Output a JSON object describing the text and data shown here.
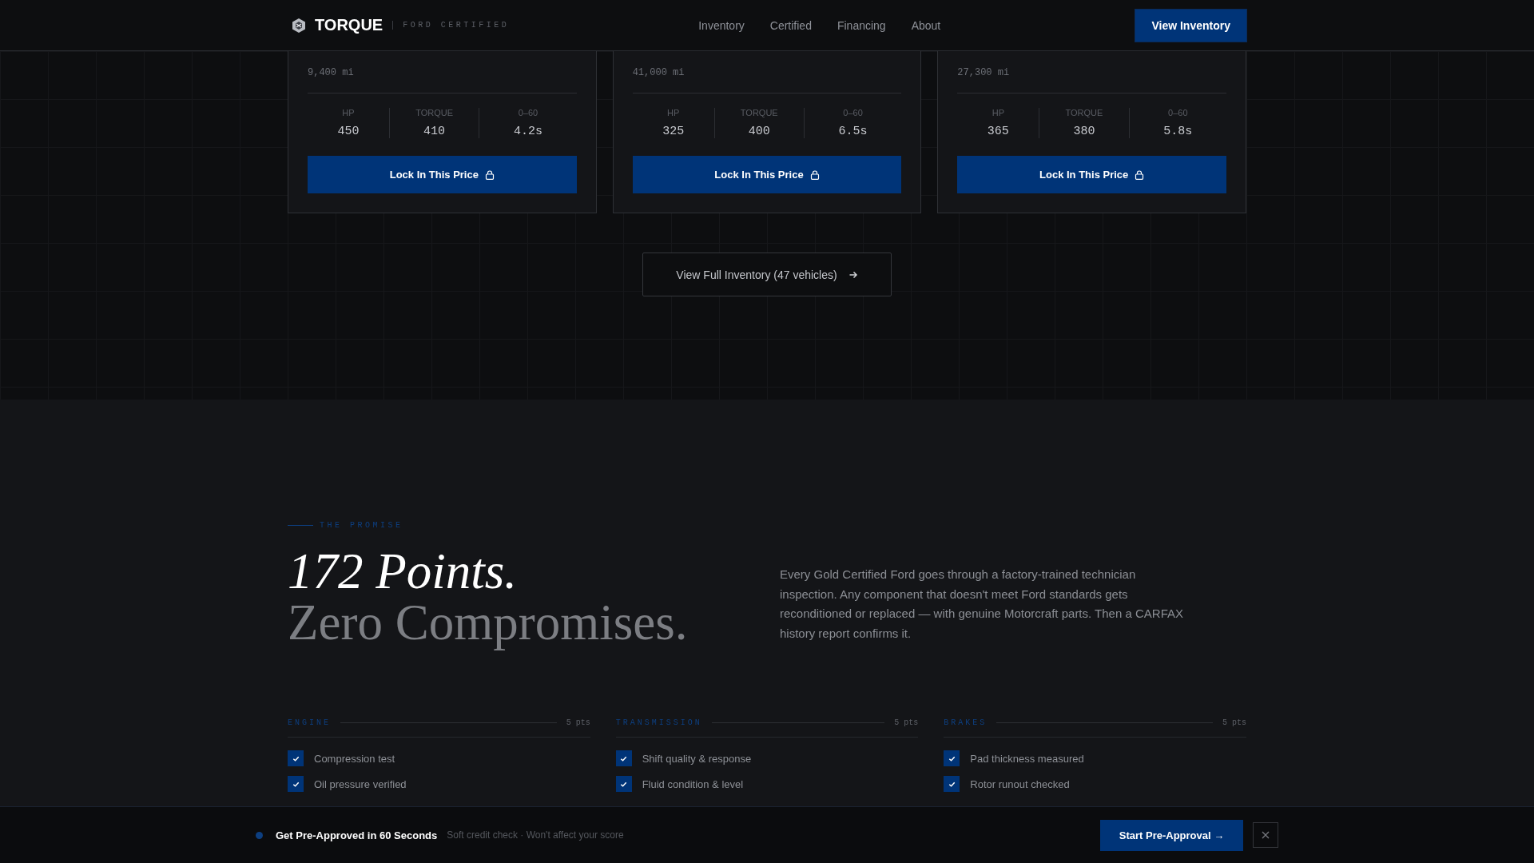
{
  "nav": {
    "brand": "TORQUE",
    "tagline": "FORD CERTIFIED",
    "links": [
      "Inventory",
      "Certified",
      "Financing",
      "About"
    ],
    "cta": "View Inventory"
  },
  "cards": [
    {
      "mileage": "9,400 mi",
      "stats": [
        {
          "label": "HP",
          "value": "450"
        },
        {
          "label": "TORQUE",
          "value": "410"
        },
        {
          "label": "0–60",
          "value": "4.2s"
        }
      ],
      "button": "Lock In This Price"
    },
    {
      "mileage": "41,000 mi",
      "stats": [
        {
          "label": "HP",
          "value": "325"
        },
        {
          "label": "TORQUE",
          "value": "400"
        },
        {
          "label": "0–60",
          "value": "6.5s"
        }
      ],
      "button": "Lock In This Price"
    },
    {
      "mileage": "27,300 mi",
      "stats": [
        {
          "label": "HP",
          "value": "365"
        },
        {
          "label": "TORQUE",
          "value": "380"
        },
        {
          "label": "0–60",
          "value": "5.8s"
        }
      ],
      "button": "Lock In This Price"
    }
  ],
  "more_button": "View Full Inventory (47 vehicles)",
  "promise": {
    "eyebrow": "THE PROMISE",
    "heading_line1": "172 Points.",
    "heading_line2": "Zero Compromises.",
    "body": "Every Gold Certified Ford goes through a factory-trained technician inspection. Any component that doesn't meet Ford standards gets reconditioned or replaced — with genuine Motorcraft parts. Then a CARFAX history report confirms it."
  },
  "checklist": [
    {
      "title": "ENGINE",
      "points": "5 pts",
      "items": [
        {
          "label": "Compression test",
          "checked": true
        },
        {
          "label": "Oil pressure verified",
          "checked": true
        }
      ]
    },
    {
      "title": "TRANSMISSION",
      "points": "5 pts",
      "items": [
        {
          "label": "Shift quality & response",
          "checked": true
        },
        {
          "label": "Fluid condition & level",
          "checked": true
        }
      ]
    },
    {
      "title": "BRAKES",
      "points": "5 pts",
      "items": [
        {
          "label": "Pad thickness measured",
          "checked": true
        },
        {
          "label": "Rotor runout checked",
          "checked": true
        }
      ]
    }
  ],
  "banner": {
    "title": "Get Pre-Approved in 60 Seconds",
    "subtitle": "Soft credit check · Won't affect your score",
    "button": "Start Pre-Approval →"
  }
}
